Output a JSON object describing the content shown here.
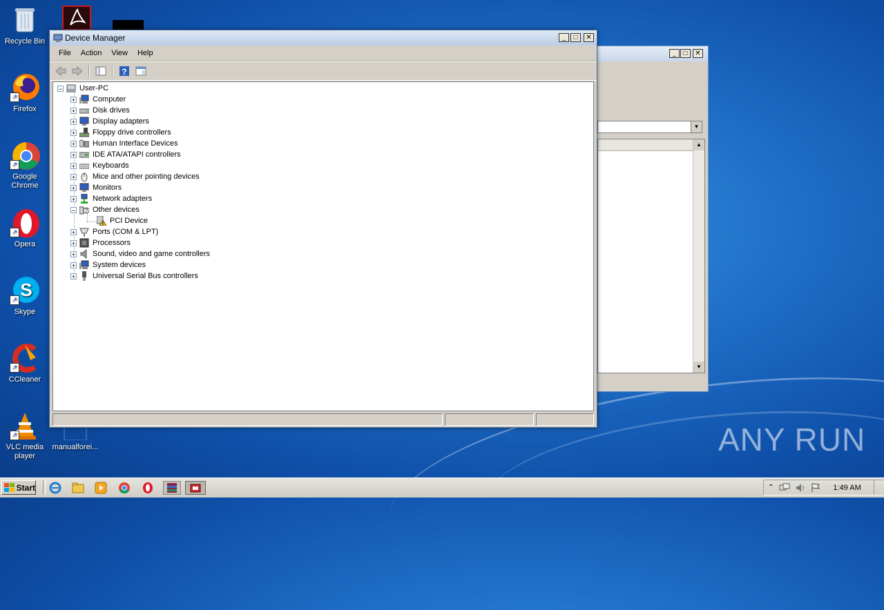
{
  "desktop": {
    "icons": [
      {
        "label": "Recycle Bin"
      },
      {
        "label": "Firefox"
      },
      {
        "label": "Google Chrome"
      },
      {
        "label": "Opera"
      },
      {
        "label": "Skype"
      },
      {
        "label": "CCleaner"
      },
      {
        "label": "VLC media player"
      },
      {
        "label": "manualforei..."
      }
    ],
    "watermark": "ANY RUN"
  },
  "window": {
    "title": "Device Manager",
    "menu": [
      "File",
      "Action",
      "View",
      "Help"
    ],
    "tree": {
      "root": "User-PC",
      "categories": [
        "Computer",
        "Disk drives",
        "Display adapters",
        "Floppy drive controllers",
        "Human Interface Devices",
        "IDE ATA/ATAPI controllers",
        "Keyboards",
        "Mice and other pointing devices",
        "Monitors",
        "Network adapters",
        "Other devices",
        "Ports (COM & LPT)",
        "Processors",
        "Sound, video and game controllers",
        "System devices",
        "Universal Serial Bus controllers"
      ],
      "other_devices_child": "PCI Device"
    }
  },
  "taskbar": {
    "start_label": "Start",
    "clock": "1:49 AM"
  },
  "colors": {
    "desktop": "#1f6fc8",
    "window_face": "#d4d0c8",
    "title_gradient_top": "#dfe9f5"
  }
}
